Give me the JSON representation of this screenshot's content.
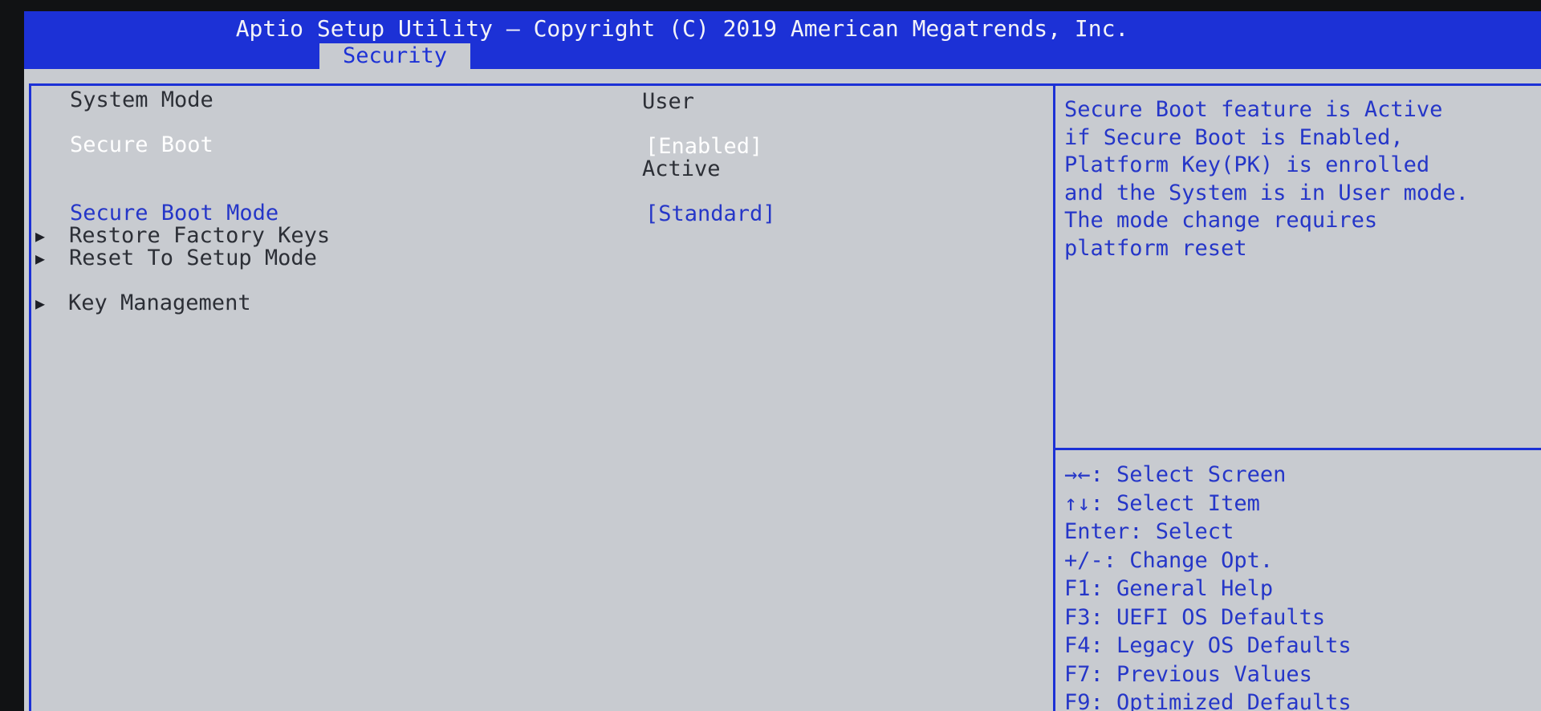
{
  "header": {
    "title": "Aptio Setup Utility – Copyright (C) 2019 American Megatrends, Inc.",
    "active_tab": "Security"
  },
  "settings": {
    "system_mode": {
      "label": "System Mode",
      "value": "User"
    },
    "secure_boot": {
      "label": "Secure Boot",
      "value": "[Enabled]",
      "status": "Active"
    },
    "secure_boot_mode": {
      "label": "Secure Boot Mode",
      "value": "[Standard]"
    },
    "submenus": [
      {
        "label": "Restore Factory Keys"
      },
      {
        "label": "Reset To Setup Mode"
      },
      {
        "label": "Key Management"
      }
    ],
    "submenu_arrow_icon": "right-triangle-icon"
  },
  "help": {
    "lines": [
      "Secure Boot feature is Active",
      "if Secure Boot is Enabled,",
      "Platform Key(PK) is enrolled",
      "and the System is in User mode.",
      "The mode change requires",
      "platform reset"
    ]
  },
  "keys": [
    "→←: Select Screen",
    "↑↓: Select Item",
    "Enter: Select",
    "+/-: Change Opt.",
    "F1: General Help",
    "F3: UEFI OS Defaults",
    "F4: Legacy OS Defaults",
    "F7: Previous Values",
    "F9: Optimized Defaults"
  ],
  "colors": {
    "title_bar": "#1c31d6",
    "background": "#c8cbd0",
    "highlight_text": "#ffffff",
    "setting_text": "#2536c8",
    "normal_text": "#2c2f36"
  }
}
